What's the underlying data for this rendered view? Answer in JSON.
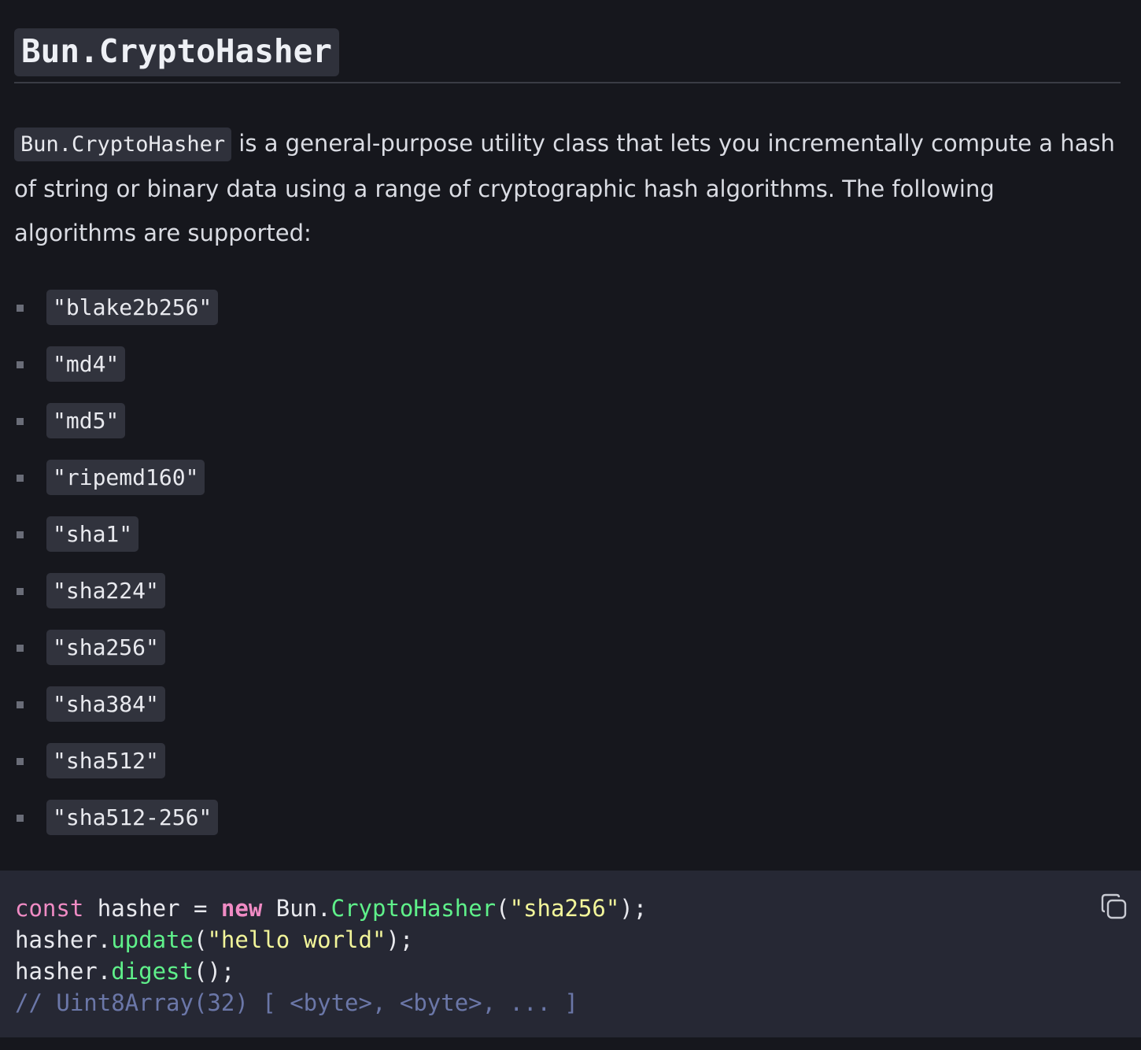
{
  "heading": "Bun.CryptoHasher",
  "intro": {
    "code": "Bun.CryptoHasher",
    "text": " is a general-purpose utility class that lets you incrementally compute a hash of string or binary data using a range of cryptographic hash algorithms. The following algorithms are supported:"
  },
  "algorithms": [
    "\"blake2b256\"",
    "\"md4\"",
    "\"md5\"",
    "\"ripemd160\"",
    "\"sha1\"",
    "\"sha224\"",
    "\"sha256\"",
    "\"sha384\"",
    "\"sha512\"",
    "\"sha512-256\""
  ],
  "code_block": {
    "line1": {
      "kw": "const",
      "var": " hasher = ",
      "new": "new",
      "obj": " Bun.",
      "fn": "CryptoHasher",
      "open": "(",
      "str": "\"sha256\"",
      "close": ");"
    },
    "line2": {
      "obj": "hasher.",
      "fn": "update",
      "open": "(",
      "str": "\"hello world\"",
      "close": ");"
    },
    "line3": {
      "obj": "hasher.",
      "fn": "digest",
      "rest": "();"
    },
    "line4": {
      "comment": "// Uint8Array(32) [ <byte>, <byte>, ... ]"
    },
    "copy_icon": "copy-icon"
  },
  "colors": {
    "background": "#16171d",
    "code_background": "#262834",
    "keyword": "#f08bc4",
    "function": "#5ff08a",
    "string": "#f2f59a",
    "comment": "#6b77a8"
  }
}
